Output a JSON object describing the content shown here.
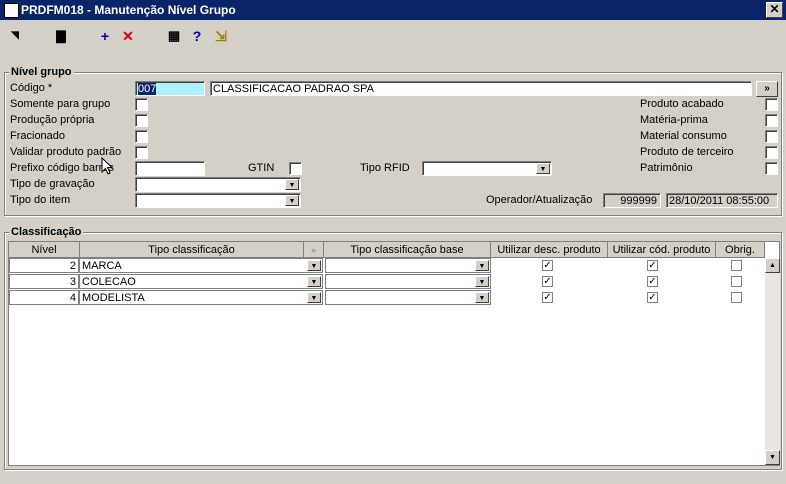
{
  "window": {
    "title": "PRDFM018 - Manutenção Nível Grupo",
    "close": "✕"
  },
  "toolbar": {
    "nav": "◥",
    "save": "▇",
    "add": "+",
    "delete": "✕",
    "grid": "▦",
    "help": "?",
    "exit": "⇲"
  },
  "nivel": {
    "title": "Nível grupo",
    "codigo_label": "Código *",
    "codigo_value": "007",
    "descricao_value": "CLASSIFICACAO PADRAO SPA",
    "more_button": "»",
    "somente_grupo": "Somente para grupo",
    "producao_propria": "Produção própria",
    "fracionado": "Fracionado",
    "validar_produto": "Validar produto padrão",
    "prefixo_label": "Prefixo código barras",
    "gtin_label": "GTIN",
    "tipo_rfid_label": "Tipo RFID",
    "tipo_gravacao_label": "Tipo de gravação",
    "tipo_item_label": "Tipo do item",
    "produto_acabado": "Produto acabado",
    "materia_prima": "Matéria-prima",
    "material_consumo": "Material consumo",
    "produto_terceiro": "Produto de terceiro",
    "patrimonio": "Patrimônio",
    "operador_label": "Operador/Atualização",
    "operador_value": "999999",
    "atualizacao_value": "28/10/2011 08:55:00"
  },
  "classificacao": {
    "title": "Classificação",
    "headers": {
      "nivel": "Nível",
      "tipo": "Tipo classificação",
      "tipo_base": "Tipo classificação base",
      "desc": "Utilizar desc. produto",
      "cod": "Utilizar cód. produto",
      "obrig": "Obrig."
    },
    "rows": [
      {
        "nivel": "2",
        "tipo": "MARCA"
      },
      {
        "nivel": "3",
        "tipo": "COLECAO"
      },
      {
        "nivel": "4",
        "tipo": "MODELISTA"
      }
    ],
    "check_mark": "✓"
  }
}
